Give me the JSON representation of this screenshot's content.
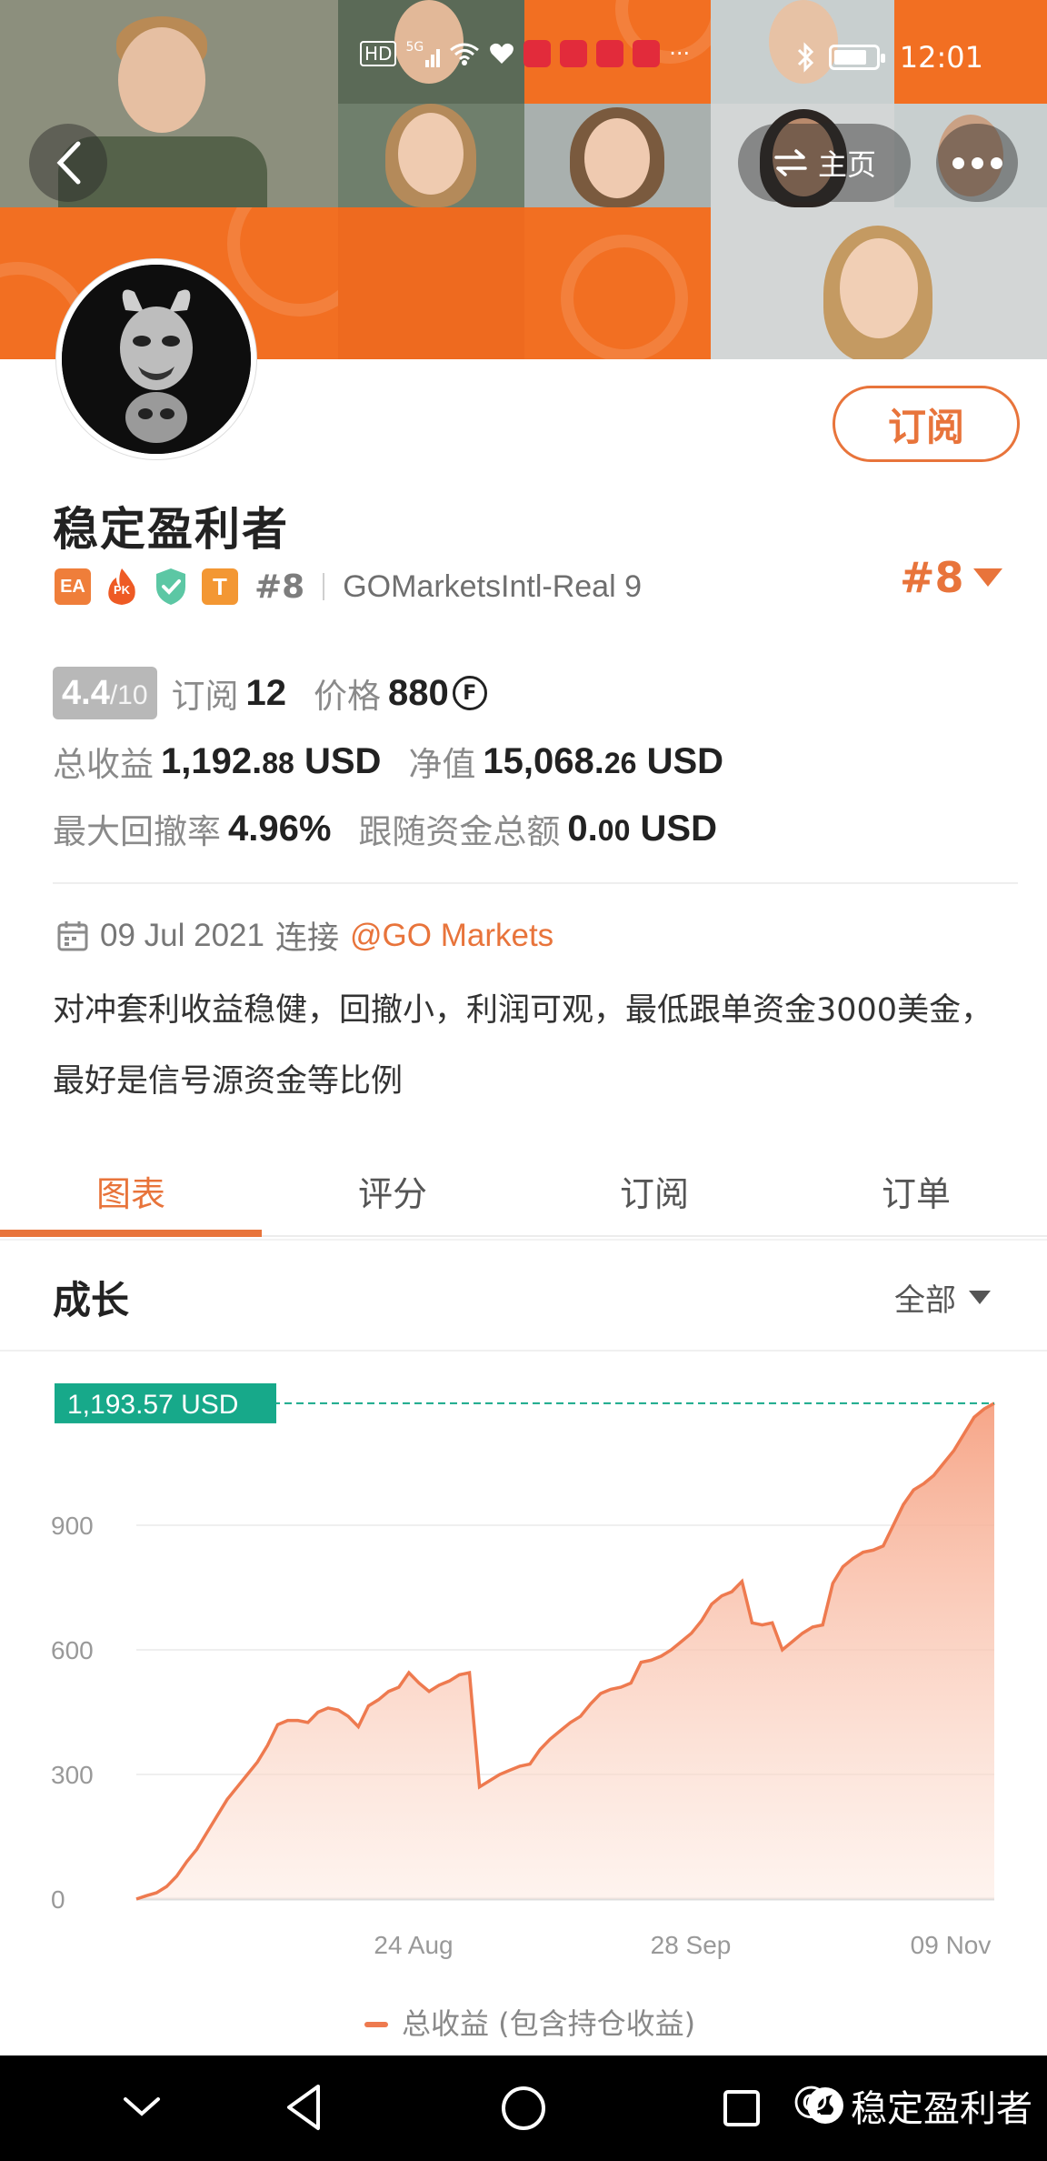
{
  "status_bar": {
    "left_indicators": [
      "HD",
      "5G"
    ],
    "time": "12:01"
  },
  "header": {
    "home_label": "主页"
  },
  "profile": {
    "name": "稳定盈利者",
    "subscribe_label": "订阅",
    "badge_ea": "EA",
    "badge_pk": "PK",
    "badge_t": "T",
    "rank": "#8",
    "account": "GOMarketsIntl-Real 9",
    "rank_dropdown": "#8"
  },
  "stats": {
    "score": "4.4",
    "score_max": "/10",
    "subscribers_label": "订阅",
    "subscribers": "12",
    "price_label": "价格",
    "price": "880",
    "price_coin": "F",
    "total_profit_label": "总收益",
    "total_profit_int": "1,192.",
    "total_profit_dec": "88",
    "total_profit_unit": "USD",
    "equity_label": "净值",
    "equity_int": "15,068.",
    "equity_dec": "26",
    "equity_unit": "USD",
    "max_drawdown_label": "最大回撤率",
    "max_drawdown": "4.96%",
    "follow_funds_label": "跟随资金总额",
    "follow_funds_int": "0.",
    "follow_funds_dec": "00",
    "follow_funds_unit": "USD"
  },
  "join_info": {
    "date": "09 Jul 2021",
    "connect_label": "连接",
    "broker": "@GO Markets"
  },
  "description": "对冲套利收益稳健，回撤小，利润可观，最低跟单资金3000美金，最好是信号源资金等比例",
  "tabs": [
    {
      "label": "图表",
      "active": true
    },
    {
      "label": "评分",
      "active": false
    },
    {
      "label": "订阅",
      "active": false
    },
    {
      "label": "订单",
      "active": false
    }
  ],
  "growth": {
    "title": "成长",
    "range_label": "全部"
  },
  "colors": {
    "accent": "#e8743b",
    "line": "#ee7a4f",
    "marker": "#17a98a"
  },
  "chart_data": {
    "type": "area",
    "x_ticks": [
      "24 Aug",
      "28 Sep",
      "09 Nov"
    ],
    "y_ticks": [
      0,
      300,
      600,
      900
    ],
    "ylim": [
      0,
      1200
    ],
    "current_value_label": "1,193.57 USD",
    "current_value": 1193.57,
    "legend": "总收益 (包含持仓收益)",
    "grid": true,
    "series": [
      {
        "values": [
          0,
          8,
          15,
          30,
          55,
          90,
          120,
          160,
          200,
          240,
          270,
          300,
          330,
          370,
          420,
          430,
          430,
          425,
          450,
          460,
          455,
          440,
          415,
          465,
          480,
          500,
          510,
          545,
          520,
          500,
          515,
          525,
          540,
          545,
          270,
          285,
          300,
          310,
          320,
          325,
          360,
          385,
          405,
          425,
          440,
          470,
          495,
          505,
          510,
          520,
          570,
          575,
          585,
          600,
          620,
          640,
          670,
          710,
          730,
          740,
          765,
          665,
          660,
          665,
          600,
          620,
          640,
          655,
          660,
          760,
          800,
          820,
          835,
          840,
          850,
          900,
          950,
          985,
          1000,
          1020,
          1050,
          1080,
          1120,
          1160,
          1180,
          1193.57
        ]
      }
    ]
  }
}
